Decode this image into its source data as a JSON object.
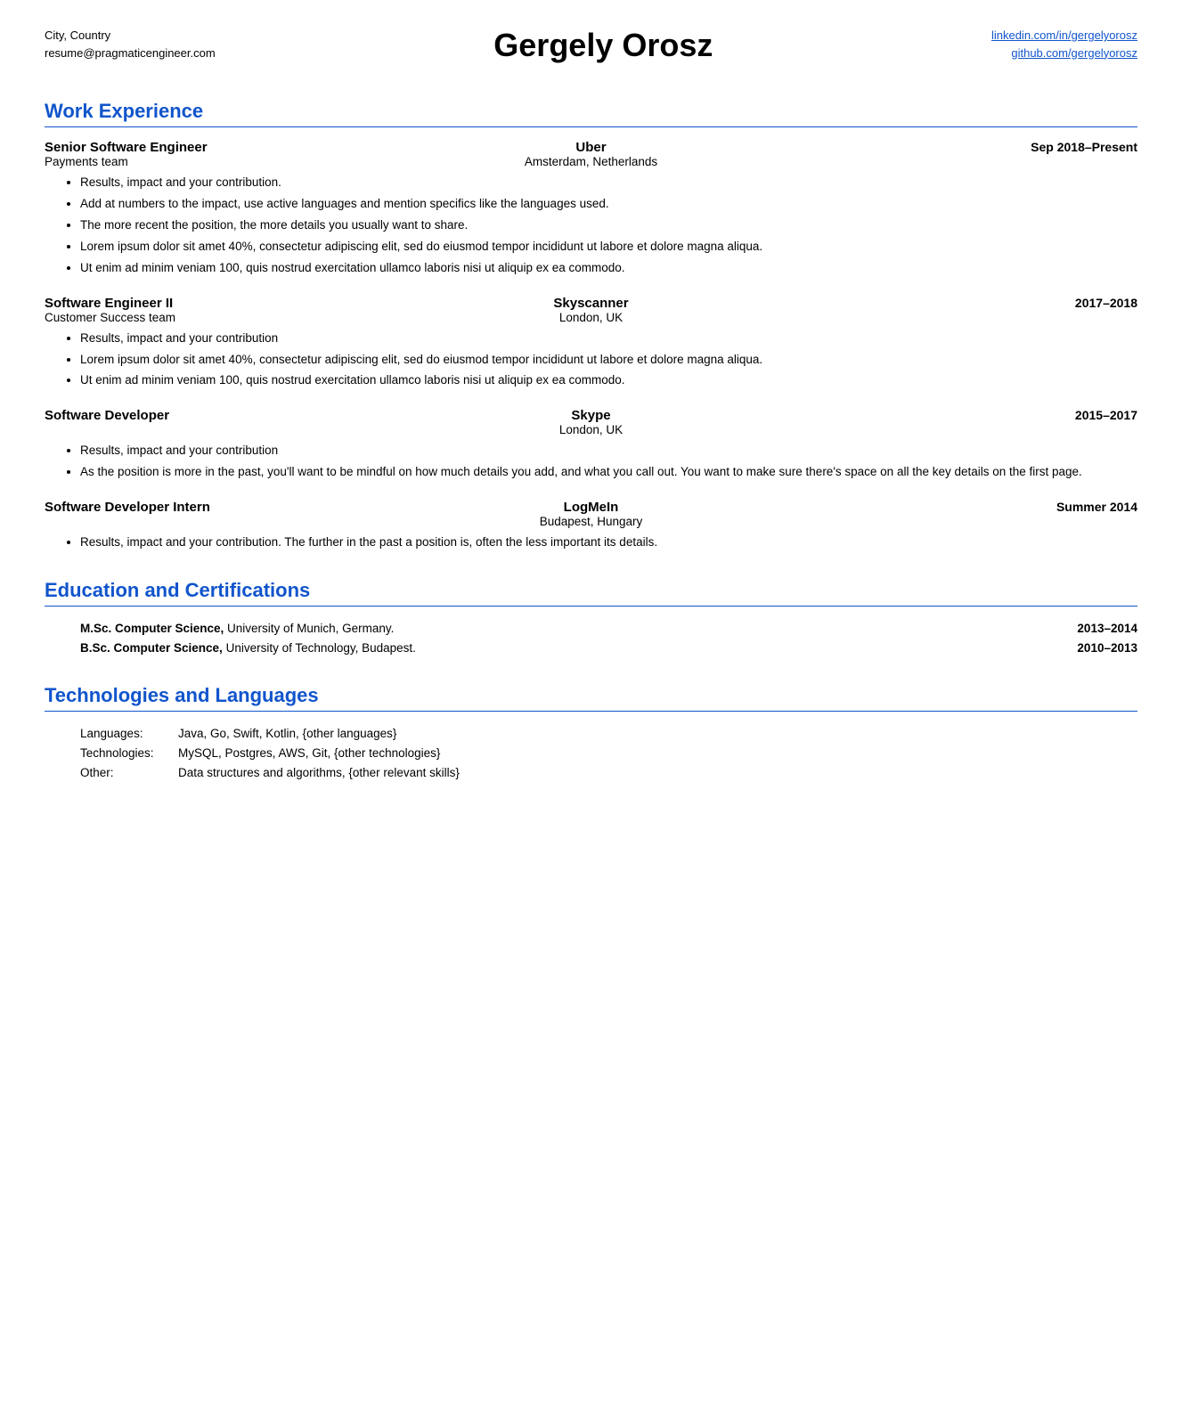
{
  "header": {
    "location": "City, Country",
    "email": "resume@pragmaticengineer.com",
    "name": "Gergely Orosz",
    "linkedin": "linkedin.com/in/gergelyorosz",
    "github": "github.com/gergelyorosz"
  },
  "sections": {
    "work_experience": {
      "title": "Work Experience",
      "jobs": [
        {
          "title": "Senior Software Engineer",
          "team": "Payments team",
          "company": "Uber",
          "location": "Amsterdam, Netherlands",
          "dates": "Sep 2018–Present",
          "bullets": [
            "Results, impact and your contribution.",
            "Add at numbers to the impact, use active languages and mention specifics like the languages used.",
            "The more recent the position, the more details you usually want to share.",
            "Lorem ipsum dolor sit amet 40%, consectetur adipiscing elit, sed do eiusmod tempor incididunt ut labore et dolore magna aliqua.",
            "Ut enim ad minim veniam 100, quis nostrud exercitation ullamco laboris nisi ut aliquip ex ea commodo."
          ]
        },
        {
          "title": "Software Engineer II",
          "team": "Customer Success team",
          "company": "Skyscanner",
          "location": "London, UK",
          "dates": "2017–2018",
          "bullets": [
            "Results, impact and your contribution",
            "Lorem ipsum dolor sit amet 40%, consectetur adipiscing elit, sed do eiusmod tempor incididunt ut labore et dolore magna aliqua.",
            "Ut enim ad minim veniam 100, quis nostrud exercitation ullamco laboris nisi ut aliquip ex ea commodo."
          ]
        },
        {
          "title": "Software Developer",
          "team": "",
          "company": "Skype",
          "location": "London, UK",
          "dates": "2015–2017",
          "bullets": [
            "Results, impact and your contribution",
            "As the position is more in the past, you'll want to be mindful on how much details you add, and what you call out. You want to make sure there's space on all the key details on the first page."
          ]
        },
        {
          "title": "Software Developer Intern",
          "team": "",
          "company": "LogMeIn",
          "location": "Budapest, Hungary",
          "dates": "Summer 2014",
          "bullets": [
            "Results, impact and your contribution. The further in the past a position is, often the less important its details."
          ]
        }
      ]
    },
    "education": {
      "title": "Education and Certifications",
      "items": [
        {
          "degree_bold": "M.Sc. Computer Science,",
          "degree_rest": " University of Munich, Germany.",
          "years": "2013–2014"
        },
        {
          "degree_bold": "B.Sc. Computer Science,",
          "degree_rest": " University of Technology, Budapest.",
          "years": "2010–2013"
        },
        {
          "degree_bold": "",
          "degree_rest": "",
          "years": ""
        }
      ]
    },
    "technologies": {
      "title": "Technologies and Languages",
      "items": [
        {
          "label": "Languages:",
          "value": "Java, Go, Swift, Kotlin, {other languages}"
        },
        {
          "label": "Technologies:",
          "value": "MySQL, Postgres, AWS, Git, {other technologies}"
        },
        {
          "label": "Other:",
          "value": "Data structures and algorithms, {other relevant skills}"
        }
      ]
    }
  }
}
